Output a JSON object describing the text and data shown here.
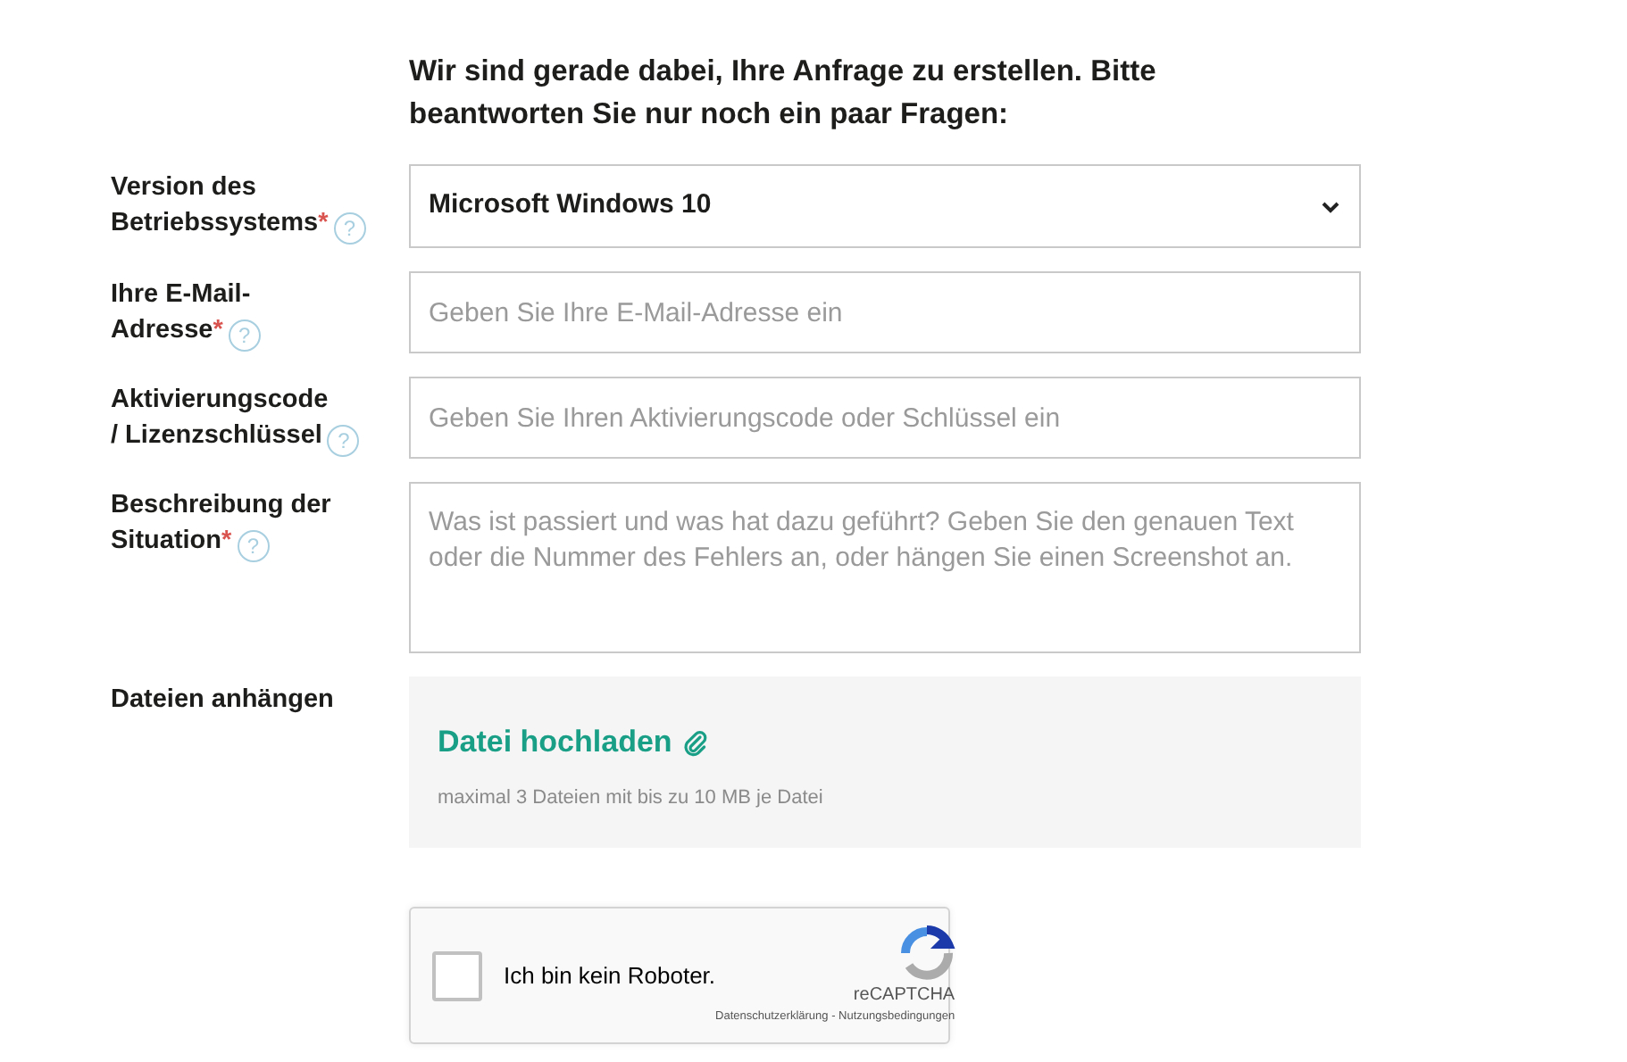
{
  "heading": "Wir sind gerade dabei, Ihre Anfrage zu erstellen. Bitte beantworten Sie nur noch ein paar Fragen:",
  "required_mark": "*",
  "fields": [
    {
      "kind": "select",
      "label_lines": [
        "Version des",
        "Betriebssystems"
      ],
      "required": true,
      "help": "?",
      "value": "Microsoft Windows 10"
    },
    {
      "kind": "input",
      "label_lines": [
        "Ihre E-Mail-",
        "Adresse"
      ],
      "required": true,
      "help": "?",
      "placeholder": "Geben Sie Ihre E-Mail-Adresse ein"
    },
    {
      "kind": "input",
      "label_lines": [
        "Aktivierungscode",
        "/ Lizenzschlüssel"
      ],
      "required": false,
      "help": "?",
      "placeholder": "Geben Sie Ihren Aktivierungscode oder Schlüssel ein"
    },
    {
      "kind": "textarea",
      "label_lines": [
        "Beschreibung der",
        "Situation"
      ],
      "required": true,
      "help": "?",
      "placeholder": "Was ist passiert und was hat dazu geführt? Geben Sie den genauen Text oder die Nummer des Fehlers an, oder hängen Sie einen Screenshot an."
    },
    {
      "kind": "upload",
      "label_lines": [
        "Dateien anhängen"
      ],
      "required": false,
      "link": "Datei hochladen",
      "hint": "maximal 3 Dateien mit bis zu 10 MB je Datei"
    }
  ],
  "captcha": {
    "label": "Ich bin kein Roboter.",
    "checked": false,
    "brand": "reCAPTCHA",
    "privacy": "Datenschutzerklärung",
    "separator": "-",
    "terms": "Nutzungsbedingungen"
  }
}
